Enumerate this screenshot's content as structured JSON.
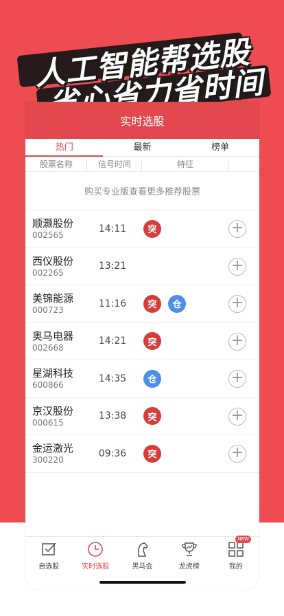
{
  "promo": {
    "line1": "人工智能帮选股",
    "line2": "省心省力省时间"
  },
  "app": {
    "title": "实时选股",
    "tabs": [
      "热门",
      "最新",
      "榜单"
    ],
    "columns": [
      "股票名称",
      "信号时间",
      "特征"
    ],
    "promo_text": "购买专业版查看更多推荐股票",
    "rows": [
      {
        "name": "顺灏股份",
        "code": "002565",
        "time": "14:11",
        "badges": [
          "red"
        ]
      },
      {
        "name": "西仪股份",
        "code": "002265",
        "time": "13:21",
        "badges": []
      },
      {
        "name": "美锦能源",
        "code": "000723",
        "time": "11:16",
        "badges": [
          "red",
          "blue"
        ]
      },
      {
        "name": "奥马电器",
        "code": "002668",
        "time": "14:21",
        "badges": [
          "red"
        ]
      },
      {
        "name": "星湖科技",
        "code": "600866",
        "time": "14:35",
        "badges": [
          "blue"
        ]
      },
      {
        "name": "京汉股份",
        "code": "000615",
        "time": "13:38",
        "badges": [
          "red"
        ]
      },
      {
        "name": "金运激光",
        "code": "300220",
        "time": "09:36",
        "badges": [
          "red"
        ]
      }
    ],
    "badge_icons": {
      "red": "突",
      "blue": "仓"
    },
    "bottom_tabs": [
      "自选股",
      "实时选股",
      "黑马会",
      "龙虎榜",
      "我的"
    ],
    "new_tag": "NEW"
  },
  "colors": {
    "accent": "#e3484e",
    "badge_red": "#d53c3c",
    "badge_blue": "#4e8fe8"
  }
}
